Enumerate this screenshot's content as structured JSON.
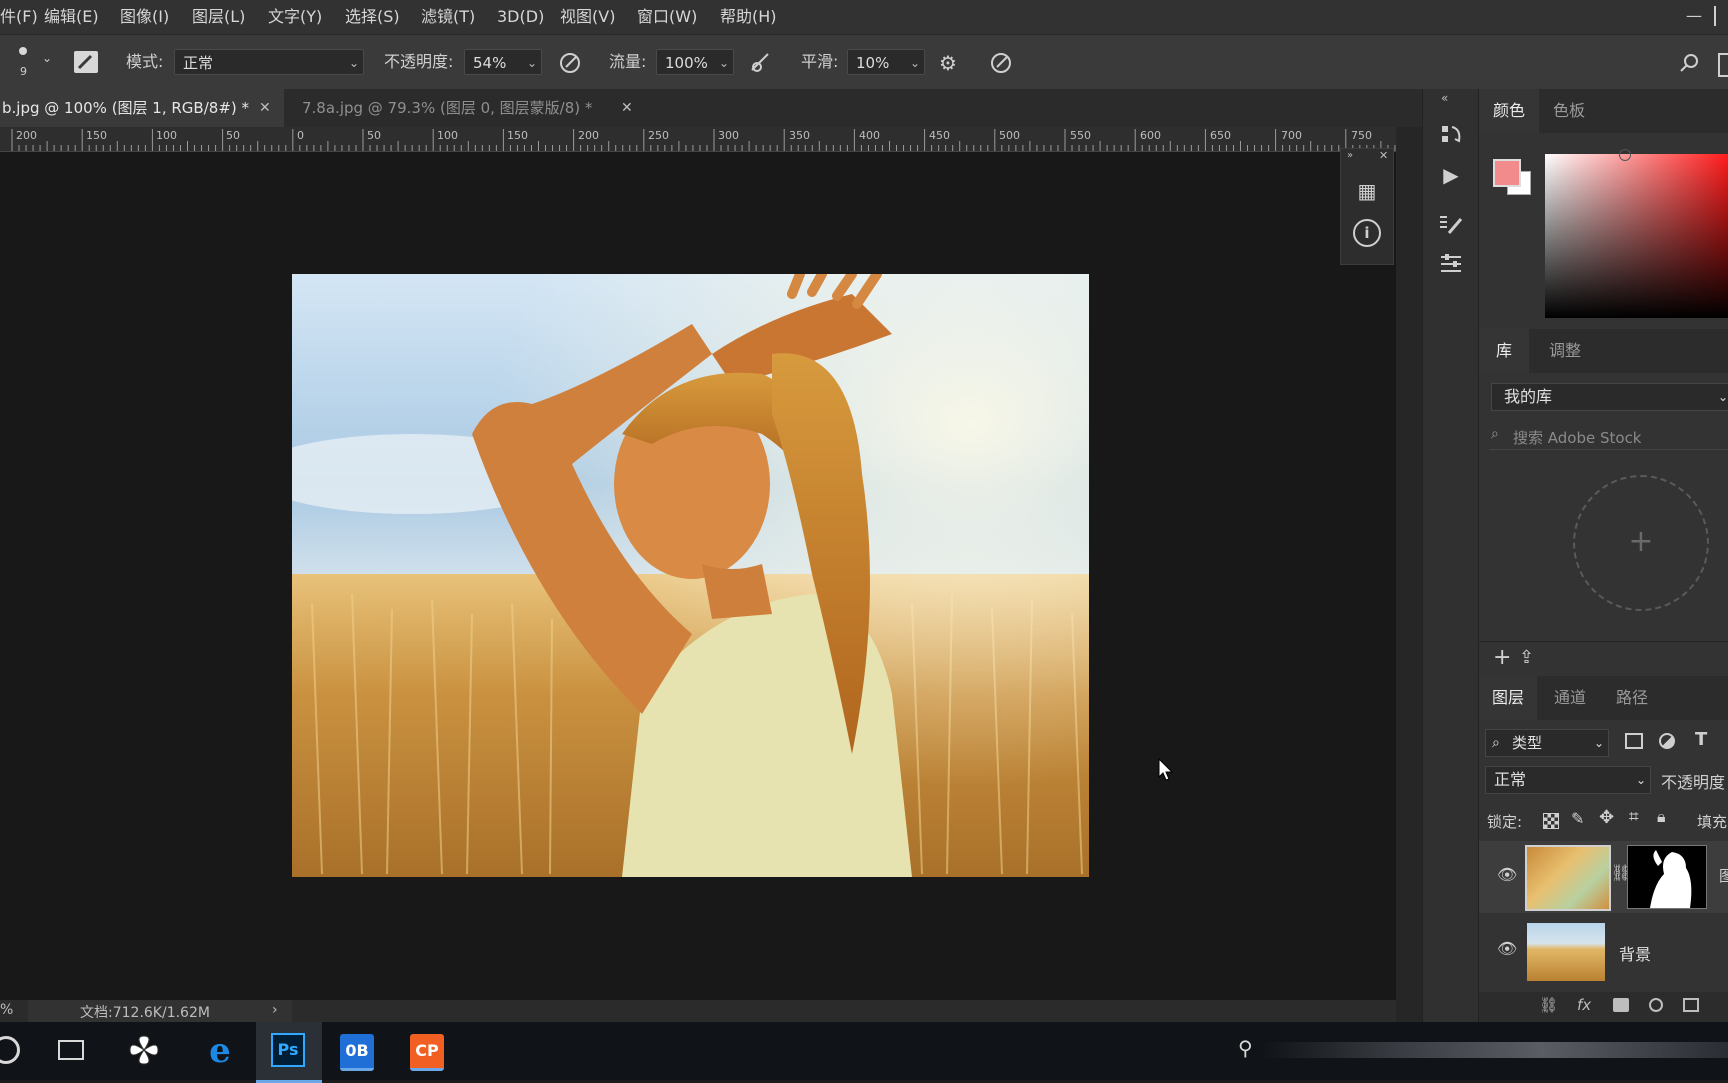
{
  "menu": {
    "items": [
      "件(F)",
      "编辑(E)",
      "图像(I)",
      "图层(L)",
      "文字(Y)",
      "选择(S)",
      "滤镜(T)",
      "3D(D)",
      "视图(V)",
      "窗口(W)",
      "帮助(H)"
    ]
  },
  "options": {
    "brush_size": "9",
    "mode_label": "模式:",
    "mode_value": "正常",
    "opacity_label": "不透明度:",
    "opacity_value": "54%",
    "flow_label": "流量:",
    "flow_value": "100%",
    "smooth_label": "平滑:",
    "smooth_value": "10%"
  },
  "tabs": [
    {
      "label": "b.jpg @ 100% (图层 1, RGB/8#) *",
      "active": true
    },
    {
      "label": "7.8a.jpg @ 79.3% (图层 0, 图层蒙版/8) *",
      "active": false
    }
  ],
  "ruler": {
    "ticks": [
      "200",
      "150",
      "100",
      "50",
      "0",
      "50",
      "100",
      "150",
      "200",
      "250",
      "300",
      "350",
      "400",
      "450",
      "500",
      "550",
      "600",
      "650",
      "700",
      "750"
    ]
  },
  "status": {
    "zoom": "%",
    "doc_info": "文档:712.6K/1.62M",
    "arrow": "›"
  },
  "color_panel": {
    "tabs": [
      "颜色",
      "色板"
    ],
    "foreground": "#f28b8b",
    "background": "#ffffff",
    "hue": "#ff1a1a"
  },
  "library_panel": {
    "tabs": [
      "库",
      "调整"
    ],
    "library_name": "我的库",
    "search_placeholder": "搜索 Adobe Stock"
  },
  "layers_panel": {
    "tabs": [
      "图层",
      "通道",
      "路径"
    ],
    "filter_label": "类型",
    "blend_mode": "正常",
    "opacity_label": "不透明度",
    "lock_label": "锁定:",
    "fill_label": "填充",
    "layers": [
      {
        "name": "图",
        "visible": true,
        "selected": true
      },
      {
        "name": "背景",
        "visible": true,
        "selected": false
      }
    ]
  },
  "taskbar": {
    "apps": [
      "Ps",
      "0B",
      "CP"
    ]
  }
}
